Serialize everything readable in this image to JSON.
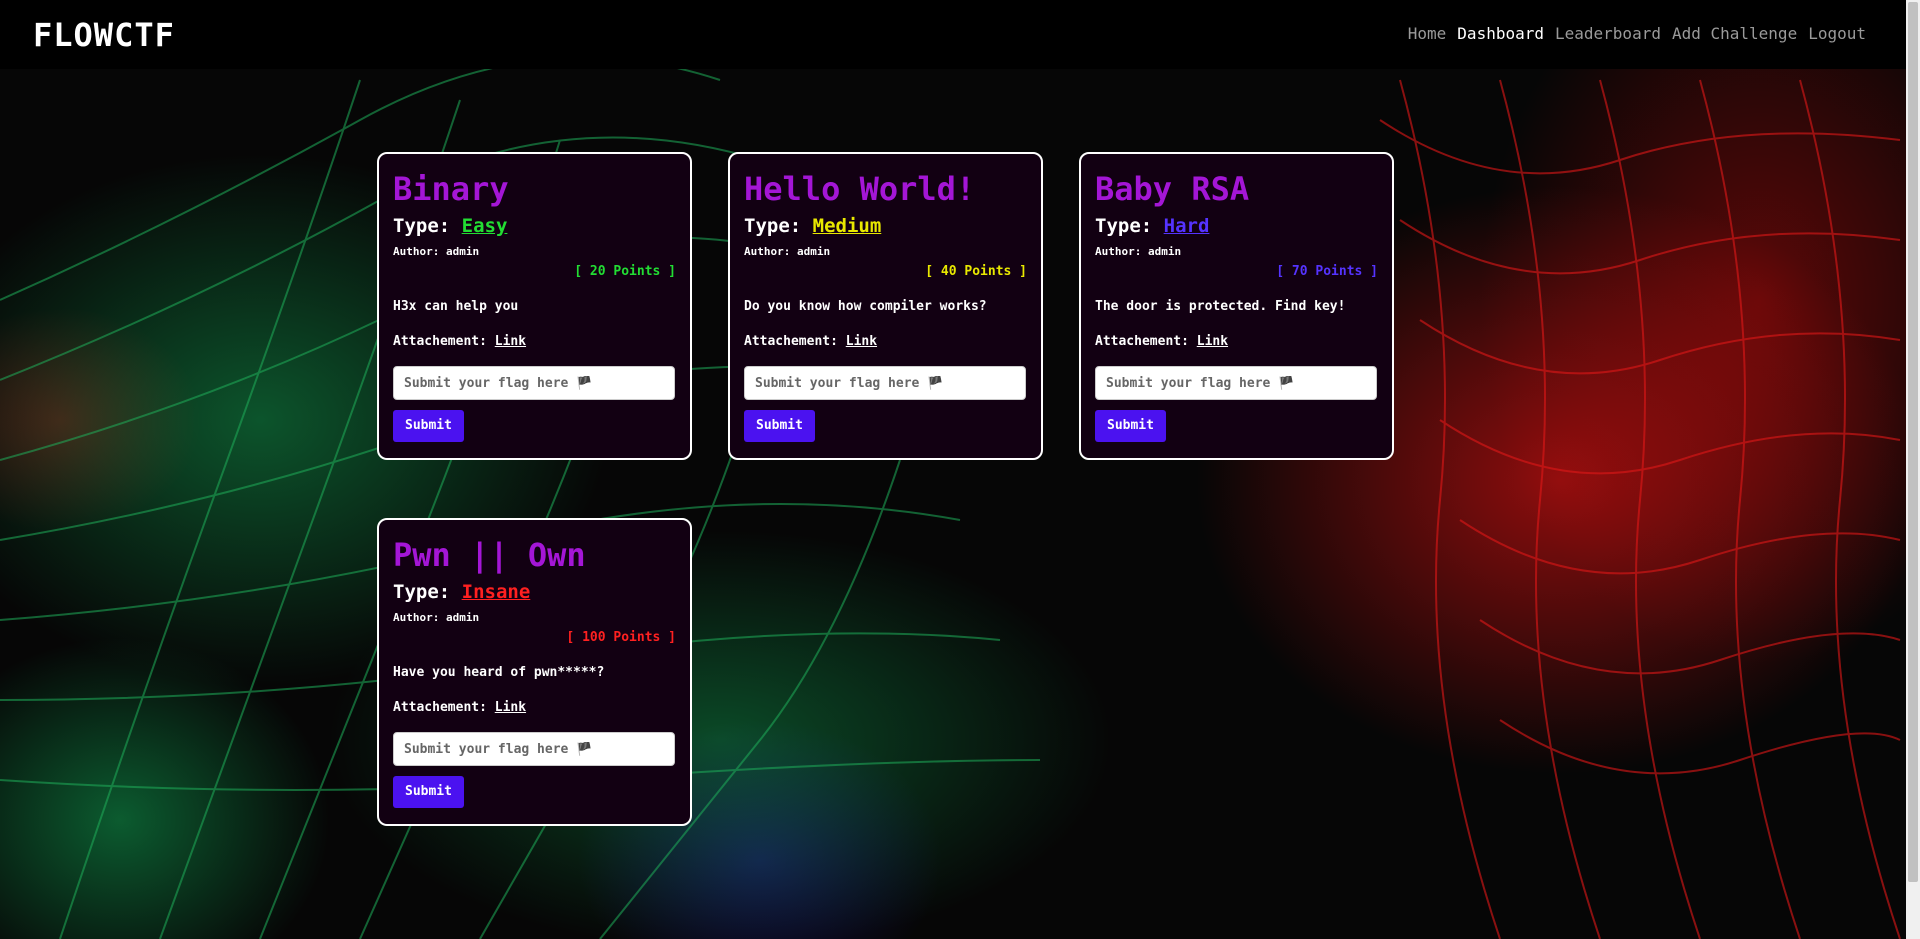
{
  "brand": "FLOWCTF",
  "nav": {
    "home": "Home",
    "dashboard": "Dashboard",
    "leaderboard": "Leaderboard",
    "add_challenge": "Add Challenge",
    "logout": "Logout"
  },
  "type_label": "Type: ",
  "attach_label": "Attachement: ",
  "challenges": [
    {
      "title": "Binary",
      "difficulty": "Easy",
      "difficulty_color": "#22dd33",
      "author": "Author: admin",
      "points": "[ 20 Points ]",
      "description": "H3x can help you",
      "link_text": "Link",
      "placeholder": "Submit your flag here 🏴",
      "submit_label": "Submit"
    },
    {
      "title": "Hello World!",
      "difficulty": "Medium",
      "difficulty_color": "#e8e800",
      "author": "Author: admin",
      "points": "[ 40 Points ]",
      "description": "Do you know how compiler works?",
      "link_text": "Link",
      "placeholder": "Submit your flag here 🏴",
      "submit_label": "Submit"
    },
    {
      "title": "Baby RSA",
      "difficulty": "Hard",
      "difficulty_color": "#5533ff",
      "author": "Author: admin",
      "points": "[ 70 Points ]",
      "description": "The door is protected. Find key!",
      "link_text": "Link",
      "placeholder": "Submit your flag here 🏴",
      "submit_label": "Submit"
    },
    {
      "title": "Pwn || Own",
      "difficulty": "Insane",
      "difficulty_color": "#ff2020",
      "author": "Author: admin",
      "points": "[ 100 Points ]",
      "description": "Have you heard of pwn*****?",
      "link_text": "Link",
      "placeholder": "Submit your flag here 🏴",
      "submit_label": "Submit"
    }
  ]
}
